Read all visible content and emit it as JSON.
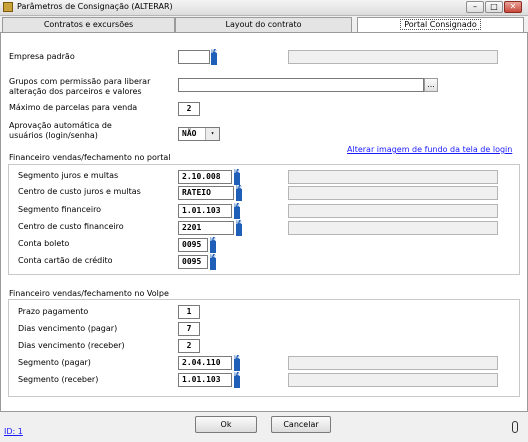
{
  "window": {
    "title": "Parâmetros de Consignação (ALTERAR)"
  },
  "tabs": [
    "Contratos e excursões",
    "Layout do contrato",
    "Portal Consignado"
  ],
  "general": {
    "empresa_label": "Empresa padrão",
    "grupos_label_1": "Grupos com permissão para liberar",
    "grupos_label_2": "alteração dos parceiros e valores",
    "maximo_label": "Máximo de parcelas para venda",
    "maximo_value": "2",
    "aprovacao_label_1": "Aprovação automática de",
    "aprovacao_label_2": "usuários (login/senha)",
    "aprovacao_value": "NÃO",
    "link_text": "Alterar imagem de fundo da tela de login"
  },
  "portal": {
    "title": "Financeiro vendas/fechamento no portal",
    "rows": [
      {
        "label": "Segmento juros e multas",
        "value": "2.10.008"
      },
      {
        "label": "Centro de custo juros e multas",
        "value": "RATEIO"
      },
      {
        "label": "Segmento financeiro",
        "value": "1.01.103"
      },
      {
        "label": "Centro de custo financeiro",
        "value": "2201"
      },
      {
        "label": "Conta boleto",
        "value": "0095"
      },
      {
        "label": "Conta cartão de crédito",
        "value": "0095"
      }
    ]
  },
  "volpe": {
    "title": "Financeiro vendas/fechamento no Volpe",
    "rows": [
      {
        "label": "Prazo pagamento",
        "value": "1"
      },
      {
        "label": "Dias vencimento (pagar)",
        "value": "7"
      },
      {
        "label": "Dias vencimento (receber)",
        "value": "2"
      },
      {
        "label": "Segmento (pagar)",
        "value": "2.04.110"
      },
      {
        "label": "Segmento (receber)",
        "value": "1.01.103"
      }
    ]
  },
  "buttons": {
    "ok": "Ok",
    "cancel": "Cancelar"
  },
  "footer": {
    "id_text": "ID: 1"
  },
  "icons": {
    "f4": "F4",
    "ellipsis": "...",
    "dropdown": "▾"
  }
}
